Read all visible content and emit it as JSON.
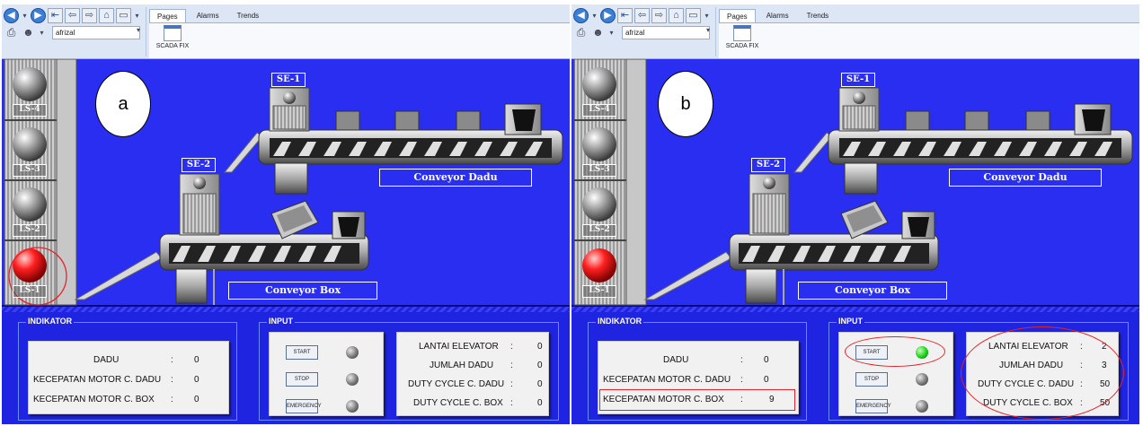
{
  "panels": [
    {
      "id": "a",
      "toolbar": {
        "user": "afrizal",
        "tabs": [
          "Pages",
          "Alarms",
          "Trends"
        ],
        "ribbon_button": "SCADA FIX"
      },
      "scene": {
        "label": "a",
        "ls_labels": [
          "LS-4",
          "LS-3",
          "LS-2",
          "LS-1"
        ],
        "sensor_labels": [
          "SE-1",
          "SE-2"
        ],
        "conveyor_dadu": "Conveyor Dadu",
        "conveyor_box": "Conveyor Box"
      },
      "indikator": {
        "title": "INDIKATOR",
        "rows": [
          {
            "label": "DADU",
            "value": "0"
          },
          {
            "label": "KECEPATAN MOTOR C. DADU",
            "value": "0"
          },
          {
            "label": "KECEPATAN MOTOR C. BOX",
            "value": "0"
          }
        ]
      },
      "input": {
        "title": "INPUT",
        "buttons": [
          "START",
          "STOP",
          "EMERGENCY"
        ]
      },
      "status": {
        "rows": [
          {
            "label": "LANTAI ELEVATOR",
            "value": "0"
          },
          {
            "label": "JUMLAH DADU",
            "value": "0"
          },
          {
            "label": "DUTY CYCLE C. DADU",
            "value": "0"
          },
          {
            "label": "DUTY CYCLE C. BOX",
            "value": "0"
          }
        ]
      }
    },
    {
      "id": "b",
      "toolbar": {
        "user": "afrizal",
        "tabs": [
          "Pages",
          "Alarms",
          "Trends"
        ],
        "ribbon_button": "SCADA FIX"
      },
      "scene": {
        "label": "b",
        "ls_labels": [
          "LS-4",
          "LS-3",
          "LS-2",
          "LS-1"
        ],
        "sensor_labels": [
          "SE-1",
          "SE-2"
        ],
        "conveyor_dadu": "Conveyor Dadu",
        "conveyor_box": "Conveyor Box"
      },
      "indikator": {
        "title": "INDIKATOR",
        "rows": [
          {
            "label": "DADU",
            "value": "0"
          },
          {
            "label": "KECEPATAN MOTOR C. DADU",
            "value": "0"
          },
          {
            "label": "KECEPATAN MOTOR C. BOX",
            "value": "9"
          }
        ]
      },
      "input": {
        "title": "INPUT",
        "buttons": [
          "START",
          "STOP",
          "EMERGENCY"
        ]
      },
      "status": {
        "rows": [
          {
            "label": "LANTAI ELEVATOR",
            "value": "2"
          },
          {
            "label": "JUMLAH DADU",
            "value": "3"
          },
          {
            "label": "DUTY CYCLE C. DADU",
            "value": "50"
          },
          {
            "label": "DUTY CYCLE C. BOX",
            "value": "50"
          }
        ]
      }
    }
  ],
  "colors": {
    "background": "#2a2ef0",
    "lamp_active_red": "#e3242b",
    "lamp_active_green": "#1bd11b",
    "annotation": "#e3242b"
  }
}
